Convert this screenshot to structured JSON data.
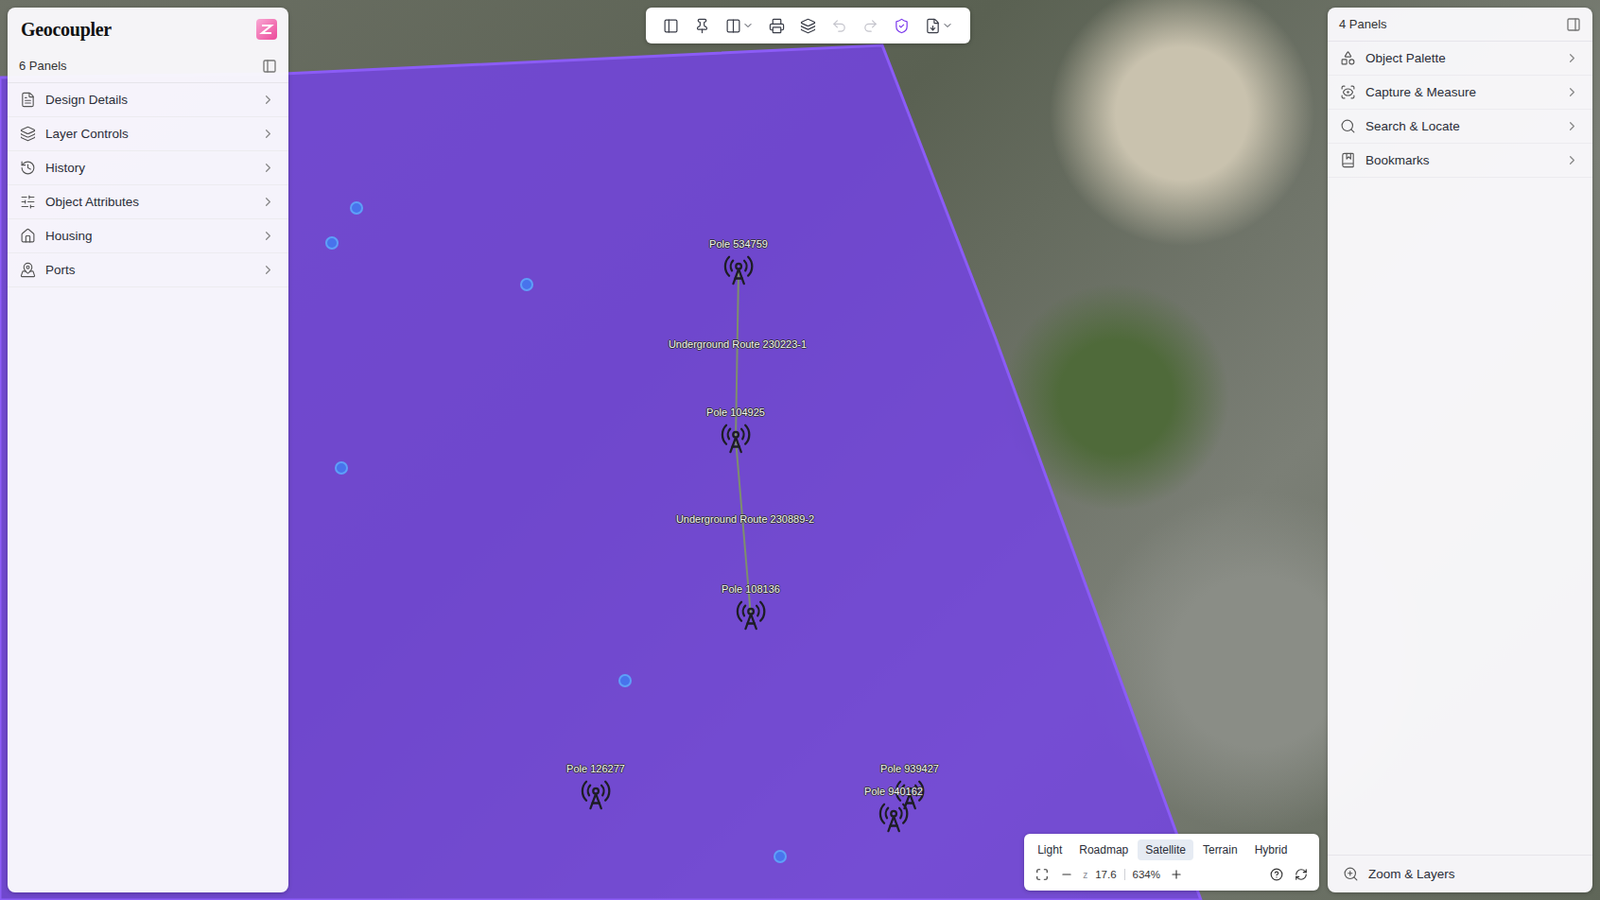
{
  "app": {
    "title": "Geocoupler"
  },
  "left_panel": {
    "title": "6 Panels",
    "items": [
      {
        "label": "Design Details",
        "kind": "document"
      },
      {
        "label": "Layer Controls",
        "kind": "layers"
      },
      {
        "label": "History",
        "kind": "history"
      },
      {
        "label": "Object Attributes",
        "kind": "attributes"
      },
      {
        "label": "Housing",
        "kind": "housing"
      },
      {
        "label": "Ports",
        "kind": "ports"
      }
    ]
  },
  "right_panel": {
    "title": "4 Panels",
    "items": [
      {
        "label": "Object Palette",
        "kind": "palette"
      },
      {
        "label": "Capture & Measure",
        "kind": "capture"
      },
      {
        "label": "Search & Locate",
        "kind": "search"
      },
      {
        "label": "Bookmarks",
        "kind": "bookmarks"
      }
    ],
    "footer": "Zoom & Layers"
  },
  "toolbar": {
    "buttons": [
      {
        "kind": "panel",
        "disabled": false,
        "active": false,
        "menu": false
      },
      {
        "kind": "pin",
        "disabled": false,
        "active": false,
        "menu": false
      },
      {
        "kind": "columns",
        "disabled": false,
        "active": false,
        "menu": true
      },
      {
        "kind": "print",
        "disabled": false,
        "active": false,
        "menu": false
      },
      {
        "kind": "layers",
        "disabled": false,
        "active": false,
        "menu": false
      },
      {
        "kind": "undo",
        "disabled": true,
        "active": false,
        "menu": false
      },
      {
        "kind": "redo",
        "disabled": true,
        "active": false,
        "menu": false
      },
      {
        "kind": "shield",
        "disabled": false,
        "active": true,
        "menu": false
      },
      {
        "kind": "export",
        "disabled": false,
        "active": false,
        "menu": true
      }
    ]
  },
  "map": {
    "poles": [
      {
        "label": "Pole 534759"
      },
      {
        "label": "Pole 104925"
      },
      {
        "label": "Pole 108136"
      },
      {
        "label": "Pole 126277"
      },
      {
        "label": "Pole 939427"
      },
      {
        "label": "Pole 940162"
      }
    ],
    "routes": [
      {
        "label": "Underground Route 230223-1"
      },
      {
        "label": "Underground Route 230889-2"
      }
    ]
  },
  "map_controls": {
    "base_layers": [
      {
        "label": "Light",
        "selected": false
      },
      {
        "label": "Roadmap",
        "selected": false
      },
      {
        "label": "Satellite",
        "selected": true
      },
      {
        "label": "Terrain",
        "selected": false
      },
      {
        "label": "Hybrid",
        "selected": false
      }
    ],
    "zoom_prefix": "z",
    "zoom": "17.6",
    "scale": "634%"
  }
}
